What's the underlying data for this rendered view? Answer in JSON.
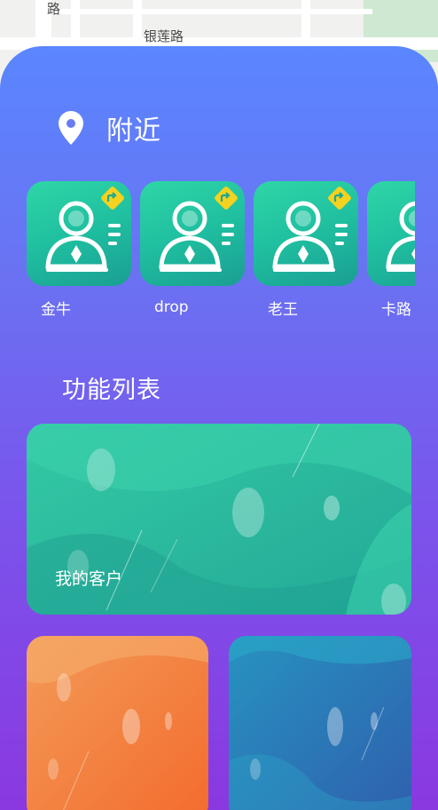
{
  "map": {
    "road_name_horizontal": "银莲路",
    "road_name_vertical_fragment": "路"
  },
  "nearby": {
    "title": "附近",
    "icon": "location-pin-icon",
    "users": [
      {
        "name": "金牛",
        "avatar_icon": "person-avatar-icon",
        "badge_icon": "navigate-badge-icon"
      },
      {
        "name": "drop",
        "avatar_icon": "person-avatar-icon",
        "badge_icon": "navigate-badge-icon"
      },
      {
        "name": "老王",
        "avatar_icon": "person-avatar-icon",
        "badge_icon": "navigate-badge-icon"
      },
      {
        "name": "卡路",
        "avatar_icon": "person-avatar-icon",
        "badge_icon": "navigate-badge-icon"
      }
    ]
  },
  "features": {
    "title": "功能列表",
    "cards": [
      {
        "label": "我的客户",
        "color": "#2fc6a2"
      },
      {
        "label": "",
        "color": "#f2843f"
      },
      {
        "label": "",
        "color": "#2f79b5"
      }
    ]
  },
  "colors": {
    "panel_top": "#5a86ff",
    "panel_bottom": "#8a38e0",
    "avatar_green": "#23c8a0",
    "badge_yellow": "#f4d21f"
  }
}
